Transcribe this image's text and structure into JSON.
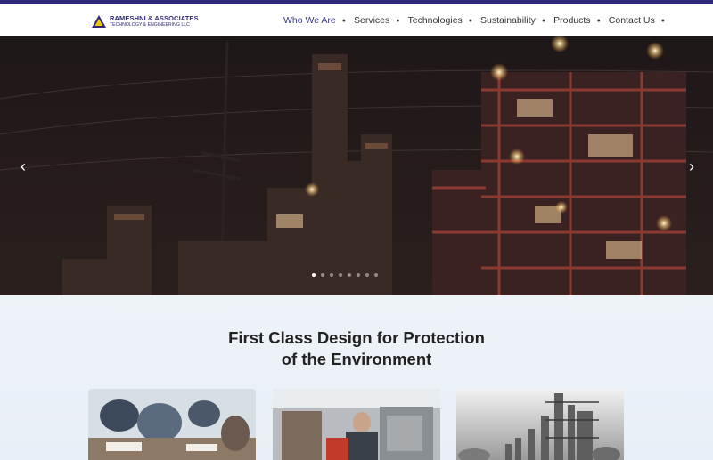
{
  "brand": {
    "line1": "RAMESHNI & ASSOCIATES",
    "line2": "TECHNOLOGY & ENGINEERING LLC",
    "color": "#2c2a78",
    "accent": "#f5c400"
  },
  "nav": {
    "items": [
      {
        "label": "Who We Are",
        "active": true
      },
      {
        "label": "Services"
      },
      {
        "label": "Technologies"
      },
      {
        "label": "Sustainability"
      },
      {
        "label": "Products"
      },
      {
        "label": "Contact Us"
      }
    ]
  },
  "hero": {
    "prev_icon": "chevron-left-icon",
    "next_icon": "chevron-right-icon",
    "slide_count": 8,
    "active_slide": 1
  },
  "main": {
    "headline_line1": "First Class Design for Protection",
    "headline_line2": "of the Environment"
  }
}
